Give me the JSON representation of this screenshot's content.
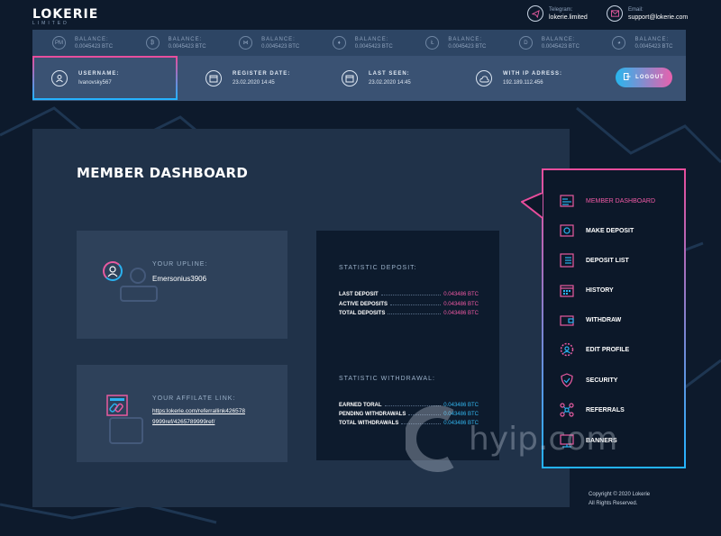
{
  "brand": {
    "name": "LOKERIE",
    "tagline": "LIMITED"
  },
  "contacts": [
    {
      "label": "Telegram:",
      "value": "lokerie.limited",
      "icon": "telegram-icon"
    },
    {
      "label": "Email:",
      "value": "support@lokerie.com",
      "icon": "email-icon"
    }
  ],
  "balances": [
    {
      "label": "BALANCE:",
      "value": "0.0045423 BTC",
      "icon": "pm-icon",
      "glyph": "PM"
    },
    {
      "label": "BALANCE:",
      "value": "0.0045423 BTC",
      "icon": "bitcoin-icon",
      "glyph": "₿"
    },
    {
      "label": "BALANCE:",
      "value": "0.0045423 BTC",
      "icon": "xmr-icon",
      "glyph": "⋈"
    },
    {
      "label": "BALANCE:",
      "value": "0.0045423 BTC",
      "icon": "ethereum-icon",
      "glyph": "♦"
    },
    {
      "label": "BALANCE:",
      "value": "0.0045423 BTC",
      "icon": "litecoin-icon",
      "glyph": "Ł"
    },
    {
      "label": "BALANCE:",
      "value": "0.0045423 BTC",
      "icon": "dash-icon",
      "glyph": "D"
    },
    {
      "label": "BALANCE:",
      "value": "0.0045423 BTC",
      "icon": "doge-icon",
      "glyph": "◕"
    }
  ],
  "account": {
    "username_label": "USERNAME:",
    "username": "Ivanovsky567",
    "register_label": "REGISTER DATE:",
    "register_date": "23.02.2020  14:45",
    "seen_label": "LAST SEEN:",
    "last_seen": "23.02.2020  14:45",
    "ip_label": "WITH IP ADRESS:",
    "ip": "192.189.112.456",
    "logout_label": "LOGOUT"
  },
  "page_title": "MEMBER DASHBOARD",
  "upline": {
    "label": "YOUR UPLINE:",
    "value": "Emersonius3906"
  },
  "affiliate": {
    "label": "YOUR AFFILATE LINK:",
    "line1": "https:lokerie.com/referrallink426578",
    "line2": "9999ref/4265789999ref/"
  },
  "deposit_stats": {
    "title": "STATISTIC DEPOSIT:",
    "rows": [
      {
        "label": "LAST DEPOSIT",
        "value": "0.043486 BTC"
      },
      {
        "label": "ACTIVE DEPOSITS",
        "value": "0.043486 BTC"
      },
      {
        "label": "TOTAL DEPOSITS",
        "value": "0.043486 BTC"
      }
    ]
  },
  "withdraw_stats": {
    "title": "STATISTIC WITHDRAWAL:",
    "rows": [
      {
        "label": "EARNED TORAL",
        "value": "0.043486 BTC"
      },
      {
        "label": "PENDING WITHDRAWALS",
        "value": "0.043486 BTC"
      },
      {
        "label": "TOTAL WITHDRAWALS",
        "value": "0.043486 BTC"
      }
    ]
  },
  "nav": [
    {
      "label": "MEMBER DASHBOARD",
      "icon": "dashboard-icon",
      "active": true
    },
    {
      "label": "MAKE DEPOSIT",
      "icon": "safe-icon"
    },
    {
      "label": "DEPOSIT LIST",
      "icon": "list-icon"
    },
    {
      "label": "HISTORY",
      "icon": "calendar-icon"
    },
    {
      "label": "WITHDRAW",
      "icon": "wallet-icon"
    },
    {
      "label": "EDIT PROFILE",
      "icon": "profile-gear-icon"
    },
    {
      "label": "SECURITY",
      "icon": "shield-icon"
    },
    {
      "label": "REFERRALS",
      "icon": "network-icon"
    },
    {
      "label": "BANNERS",
      "icon": "banner-icon"
    }
  ],
  "footer": {
    "line1": "Copyright © 2020 Lokerie",
    "line2": "All Rights Reserved."
  },
  "watermark": "hyip.com",
  "colors": {
    "pink": "#f05aa5",
    "blue": "#33b7f0",
    "panel": "#203249",
    "strip": "#3a5273"
  }
}
